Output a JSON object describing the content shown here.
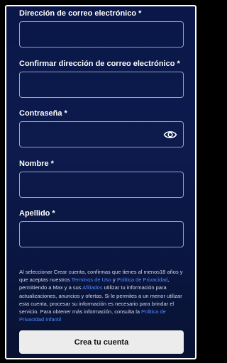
{
  "form": {
    "email": {
      "label": "Dirección de correo electrónico",
      "required_mark": "*",
      "value": ""
    },
    "confirm_email": {
      "label": "Confirmar dirección de correo electrónico",
      "required_mark": "*",
      "value": ""
    },
    "password": {
      "label": "Contraseña",
      "required_mark": "*",
      "value": "",
      "toggle_icon": "eye-icon"
    },
    "first_name": {
      "label": "Nombre",
      "required_mark": "*",
      "value": ""
    },
    "last_name": {
      "label": "Apellido",
      "required_mark": "*",
      "value": ""
    }
  },
  "legal": {
    "t1": "Al seleccionar Crear cuenta, confirmas que tienes al menos18 años y que aceptas nuestros ",
    "terms_link": "Terminos de Uso",
    "t2": " y ",
    "privacy_link": "Politica de Privacidad",
    "t3": ", permitiendo a Max y a sus ",
    "affiliates_link": "Afiliados",
    "t4": " utilizar tu información para actualizaciones, anuncios y ofertas. Si le permites a un menor utilizar esta cuenta, procesar su información es necesario para brindar el servicio. Para obtener más información, consulta la ",
    "child_privacy_link": "Politica de Privacidad Infantil"
  },
  "cta": {
    "label": "Crea tu cuenta"
  },
  "colors": {
    "background": "#0c1a4d",
    "link": "#4f8cff",
    "button": "#ececec"
  }
}
